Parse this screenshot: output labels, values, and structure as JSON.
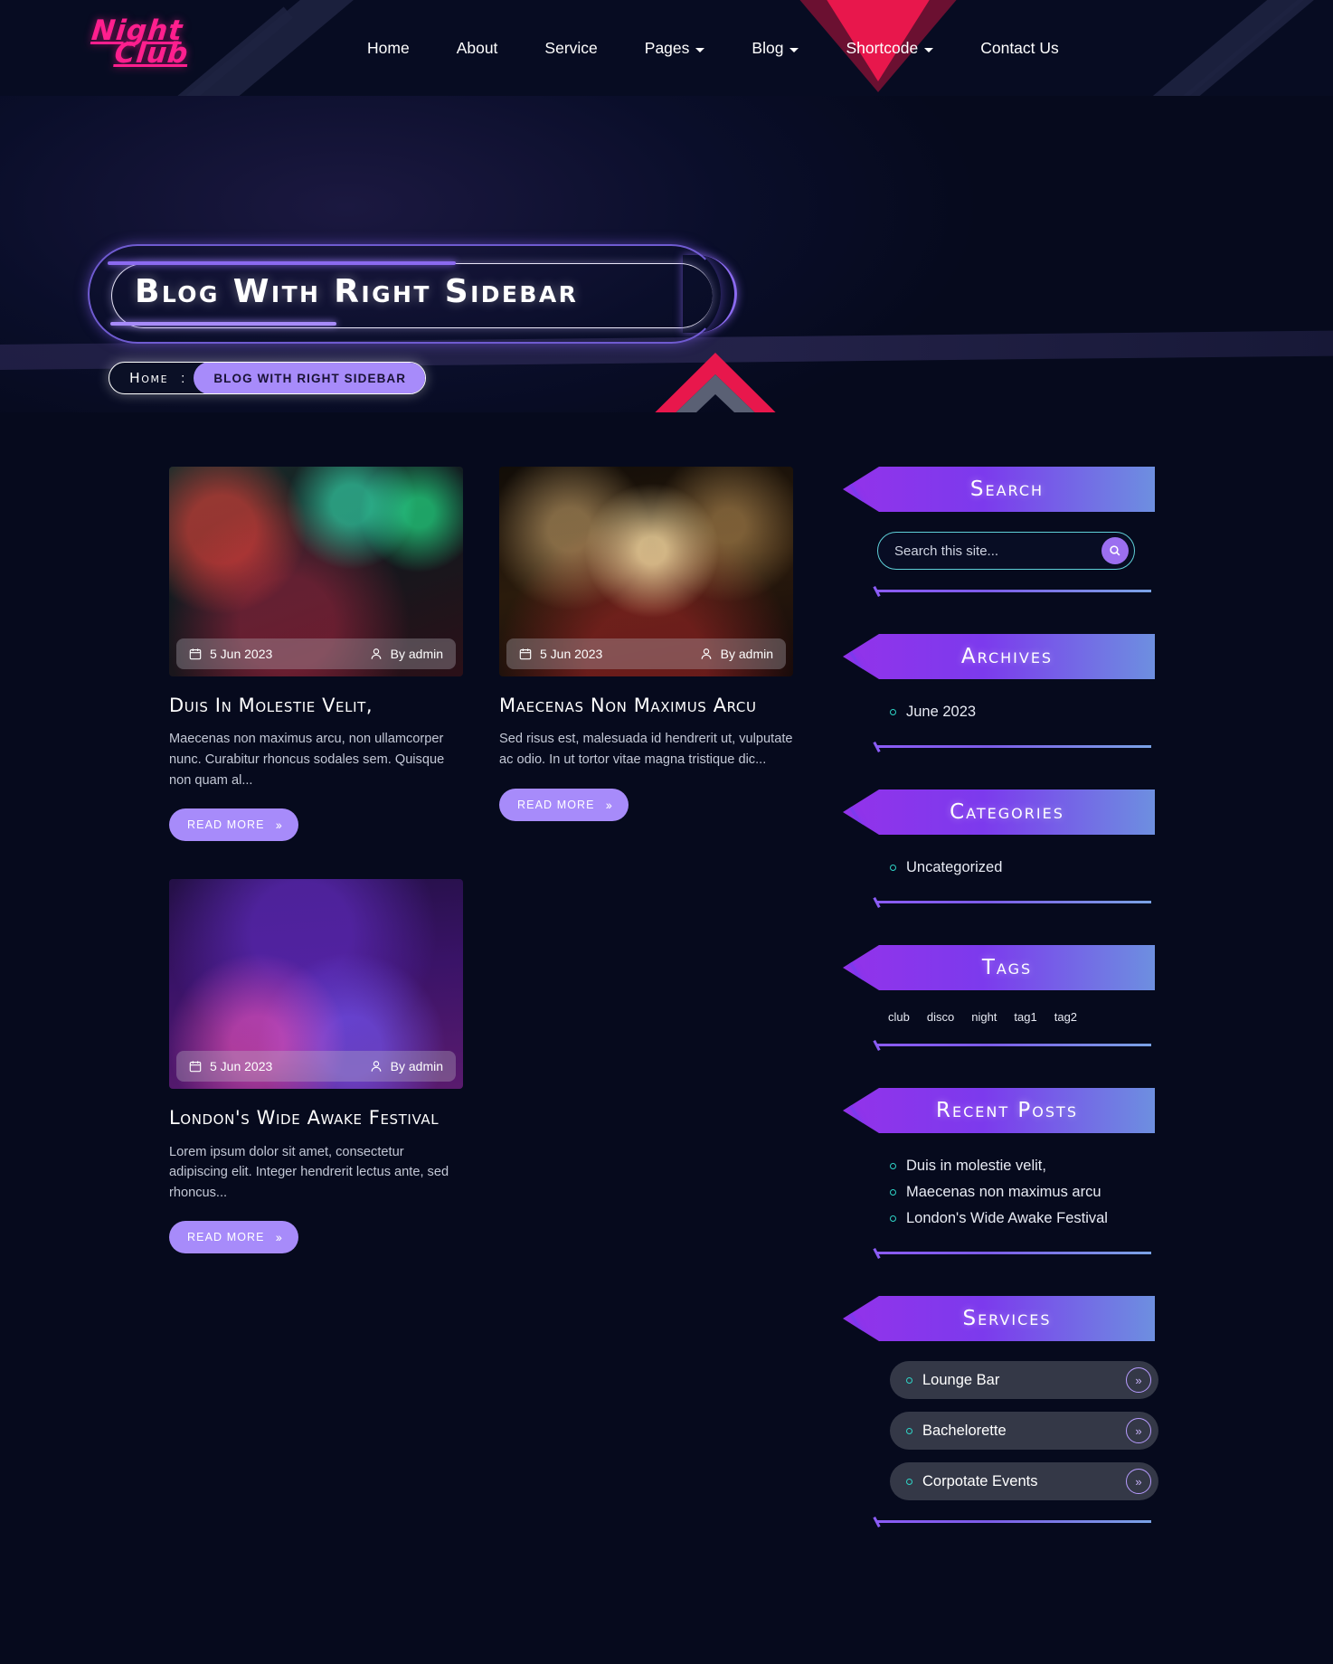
{
  "brand": {
    "line1": "Night",
    "line2": "Club"
  },
  "nav": {
    "items": [
      {
        "label": "Home",
        "has_caret": false
      },
      {
        "label": "About",
        "has_caret": false
      },
      {
        "label": "Service",
        "has_caret": false
      },
      {
        "label": "Pages",
        "has_caret": true
      },
      {
        "label": "Blog",
        "has_caret": true
      },
      {
        "label": "Shortcode",
        "has_caret": true
      },
      {
        "label": "Contact Us",
        "has_caret": false
      }
    ]
  },
  "hero": {
    "title": "Blog With Right Sidebar",
    "breadcrumb": {
      "home": "Home",
      "separator": ":",
      "current": "BLOG WITH RIGHT SIDEBAR"
    }
  },
  "posts": [
    {
      "date": "5 Jun 2023",
      "author": "By admin",
      "title": "Duis in molestie velit,",
      "excerpt": "Maecenas non maximus arcu, non ullamcorper nunc. Curabitur rhoncus sodales sem. Quisque non quam al...",
      "button": "READ MORE",
      "arrow": "››",
      "image": "nightclub-crowd-photo"
    },
    {
      "date": "5 Jun 2023",
      "author": "By admin",
      "title": "Maecenas non maximus arcu",
      "excerpt": "Sed risus est, malesuada id hendrerit ut, vulputate ac odio. In ut tortor vitae magna tristique dic...",
      "button": "READ MORE",
      "arrow": "››",
      "image": "live-band-stage-photo"
    },
    {
      "date": "5 Jun 2023",
      "author": "By admin",
      "title": "London's Wide Awake Festival",
      "excerpt": "Lorem ipsum dolor sit amet, consectetur adipiscing elit. Integer hendrerit lectus ante, sed rhoncus...",
      "button": "READ MORE",
      "arrow": "››",
      "image": "dj-turntable-photo"
    }
  ],
  "sidebar": {
    "search": {
      "title": "Search",
      "placeholder": "Search this site...",
      "value": "",
      "icon": "search-icon"
    },
    "archives": {
      "title": "Archives",
      "items": [
        "June 2023"
      ]
    },
    "categories": {
      "title": "Categories",
      "items": [
        "Uncategorized"
      ]
    },
    "tags": {
      "title": "Tags",
      "items": [
        "club",
        "disco",
        "night",
        "tag1",
        "tag2"
      ]
    },
    "recent_posts": {
      "title": "Recent Posts",
      "items": [
        "Duis in molestie velit,",
        "Maecenas non maximus arcu",
        "London's Wide Awake Festival"
      ]
    },
    "services": {
      "title": "Services",
      "items": [
        "Lounge Bar",
        "Bachelorette",
        "Corpotate Events"
      ]
    }
  },
  "colors": {
    "background": "#060a1d",
    "brand_pink": "#ff1f8e",
    "accent_purple": "#a78bfa",
    "gradient_start": "#9333ea",
    "gradient_end": "#6d8fe0",
    "teal_bullet": "#2fd4c6",
    "red_chevron": "#e8174c"
  }
}
